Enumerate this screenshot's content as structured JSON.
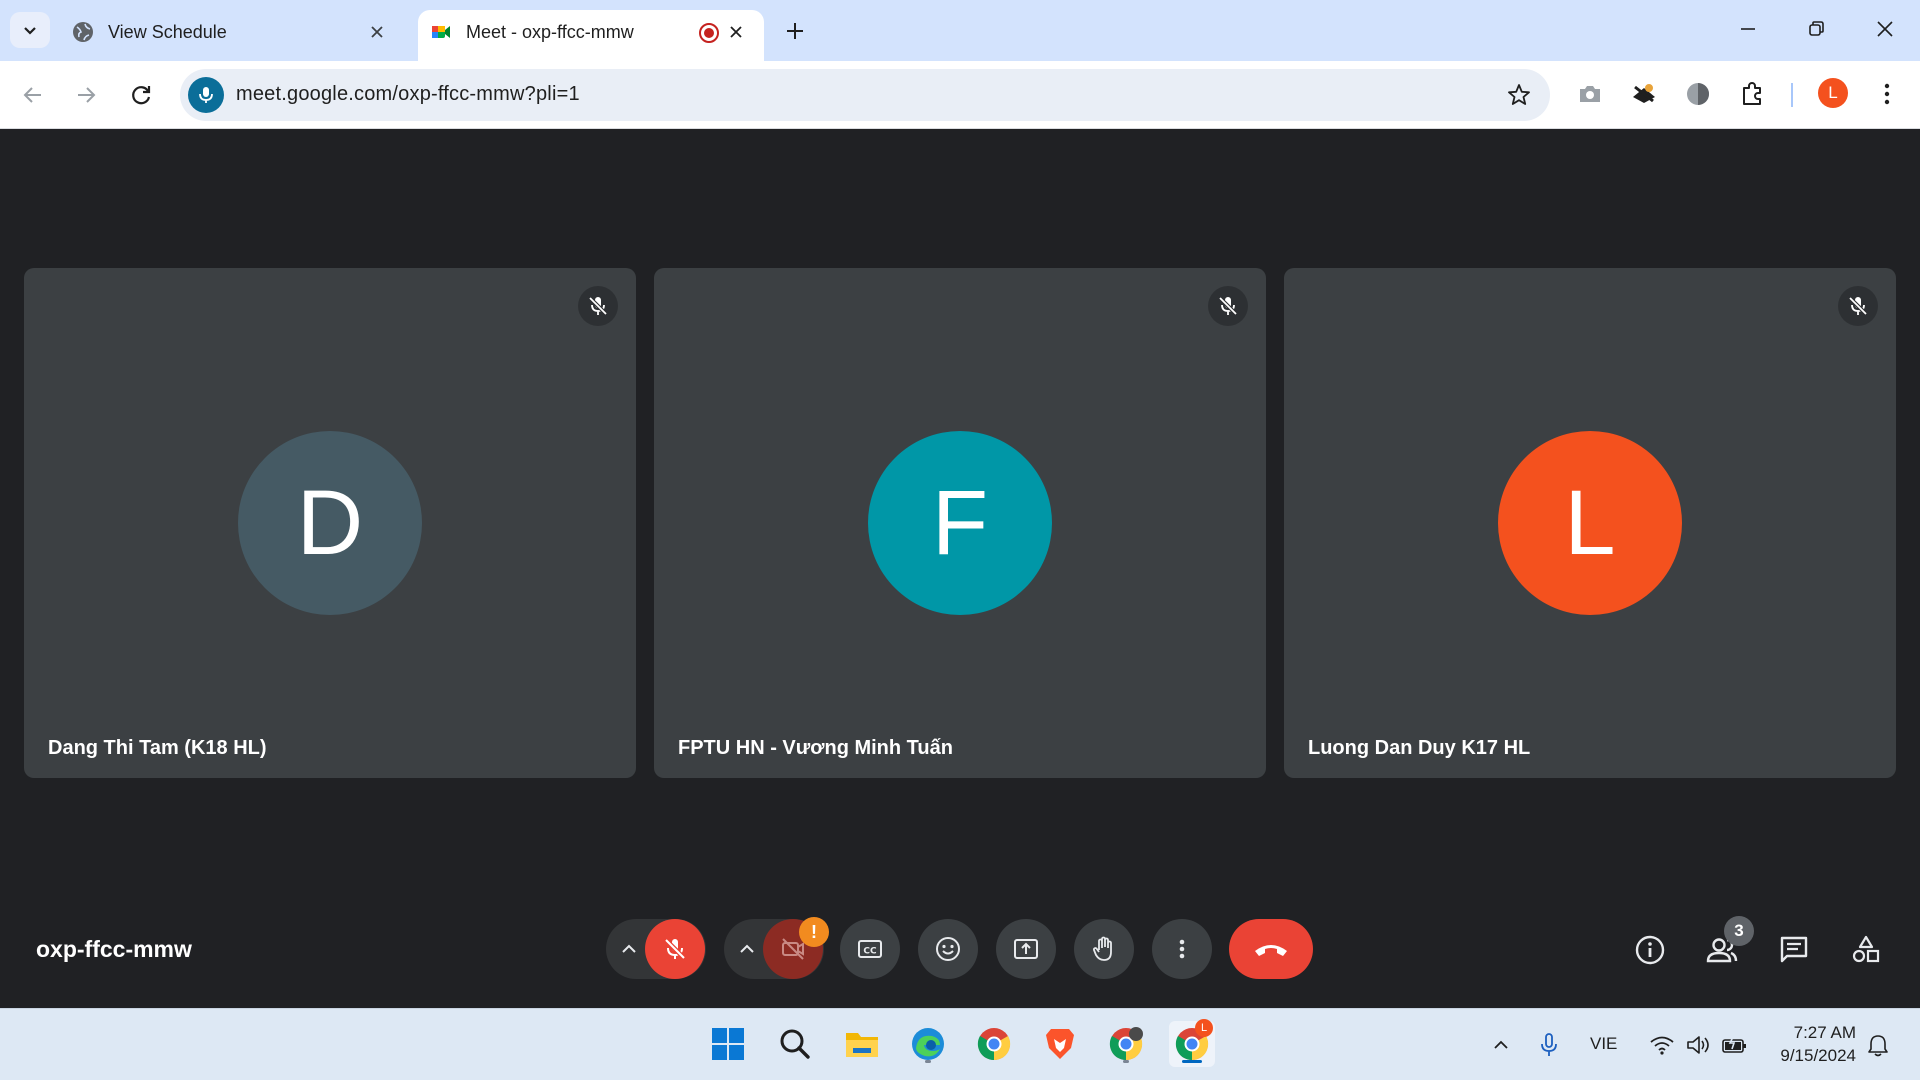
{
  "browser": {
    "tabs": [
      {
        "title": "View Schedule",
        "active": false,
        "favicon": "globe-icon"
      },
      {
        "title": "Meet - oxp-ffcc-mmw",
        "active": true,
        "favicon": "google-meet-icon",
        "recording": true
      }
    ],
    "address": {
      "url": "meet.google.com/oxp-ffcc-mmw?pli=1"
    },
    "profile_initial": "L"
  },
  "meet": {
    "meeting_code": "oxp-ffcc-mmw",
    "participants": [
      {
        "name": "Dang Thi Tam (K18 HL)",
        "initial": "D",
        "color": "#455a64",
        "muted": true
      },
      {
        "name": "FPTU HN - Vương Minh Tuấn",
        "initial": "F",
        "color": "#0097a7",
        "muted": true
      },
      {
        "name": "Luong Dan Duy K17 HL",
        "initial": "L",
        "color": "#f4511e",
        "muted": true
      }
    ],
    "camera_warning": "!",
    "participant_count": "3"
  },
  "taskbar": {
    "language": "VIE",
    "time": "7:27 AM",
    "date": "9/15/2024",
    "chrome_badge": "L"
  },
  "colors": {
    "meet_bg": "#202124",
    "tile_bg": "#3c4043",
    "danger": "#ea4335",
    "tabbar_bg": "#d3e3fd"
  }
}
